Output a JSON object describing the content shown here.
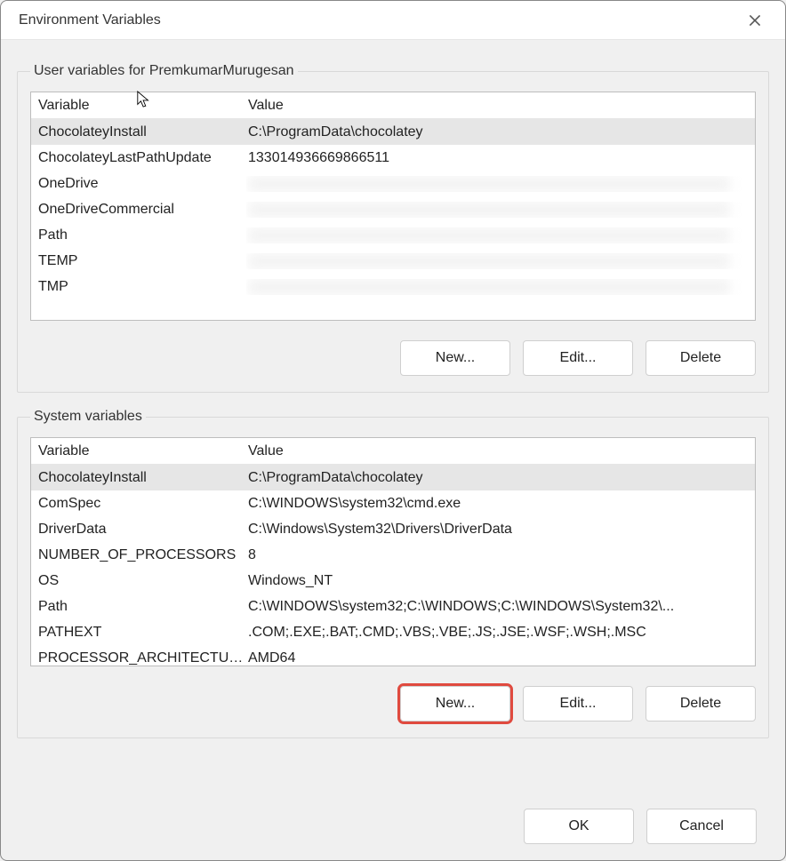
{
  "window": {
    "title": "Environment Variables"
  },
  "user_section": {
    "legend": "User variables for PremkumarMurugesan",
    "header_var": "Variable",
    "header_val": "Value",
    "rows": [
      {
        "var": "ChocolateyInstall",
        "val": "C:\\ProgramData\\chocolatey",
        "selected": true
      },
      {
        "var": "ChocolateyLastPathUpdate",
        "val": "133014936669866511"
      },
      {
        "var": "OneDrive",
        "val": "",
        "blurred": true
      },
      {
        "var": "OneDriveCommercial",
        "val": "",
        "blurred": true
      },
      {
        "var": "Path",
        "val": "",
        "blurred": true
      },
      {
        "var": "TEMP",
        "val": "",
        "blurred": true
      },
      {
        "var": "TMP",
        "val": "",
        "blurred": true
      }
    ],
    "buttons": {
      "new": "New...",
      "edit": "Edit...",
      "delete": "Delete"
    }
  },
  "system_section": {
    "legend": "System variables",
    "header_var": "Variable",
    "header_val": "Value",
    "rows": [
      {
        "var": "ChocolateyInstall",
        "val": "C:\\ProgramData\\chocolatey",
        "selected": true
      },
      {
        "var": "ComSpec",
        "val": "C:\\WINDOWS\\system32\\cmd.exe"
      },
      {
        "var": "DriverData",
        "val": "C:\\Windows\\System32\\Drivers\\DriverData"
      },
      {
        "var": "NUMBER_OF_PROCESSORS",
        "val": "8"
      },
      {
        "var": "OS",
        "val": "Windows_NT"
      },
      {
        "var": "Path",
        "val": "C:\\WINDOWS\\system32;C:\\WINDOWS;C:\\WINDOWS\\System32\\..."
      },
      {
        "var": "PATHEXT",
        "val": ".COM;.EXE;.BAT;.CMD;.VBS;.VBE;.JS;.JSE;.WSF;.WSH;.MSC"
      },
      {
        "var": "PROCESSOR_ARCHITECTURE",
        "val": "AMD64"
      }
    ],
    "buttons": {
      "new": "New...",
      "edit": "Edit...",
      "delete": "Delete"
    }
  },
  "footer": {
    "ok": "OK",
    "cancel": "Cancel"
  }
}
